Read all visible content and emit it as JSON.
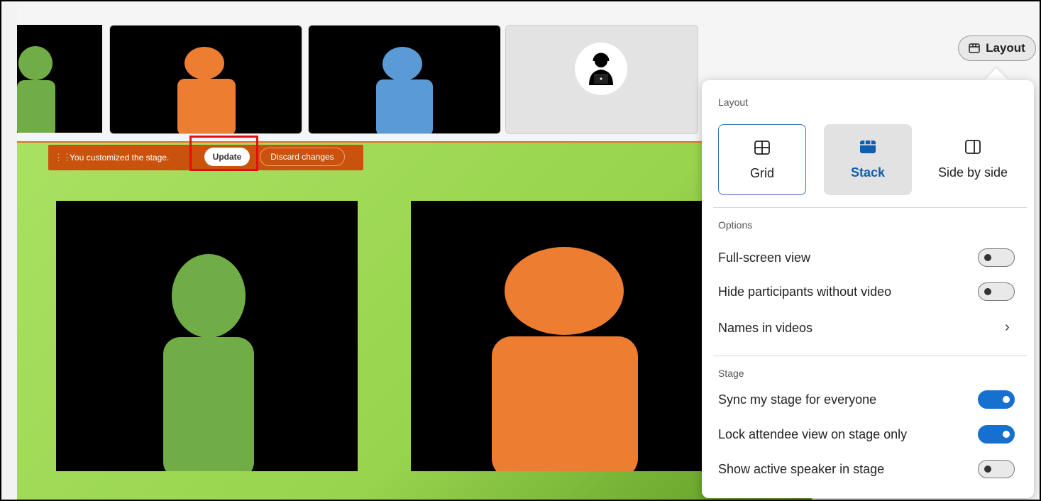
{
  "banner": {
    "message": "You customized the stage.",
    "update_label": "Update",
    "discard_label": "Discard changes"
  },
  "layout_button": {
    "label": "Layout",
    "icon": "layout-icon"
  },
  "panel": {
    "layout_section": "Layout",
    "options": [
      {
        "label": "Grid",
        "icon": "grid-icon",
        "selected": false
      },
      {
        "label": "Stack",
        "icon": "stack-icon",
        "selected": true
      },
      {
        "label": "Side by side",
        "icon": "side-by-side-icon",
        "selected": false
      }
    ],
    "options_section": "Options",
    "full_screen": {
      "label": "Full-screen view",
      "on": false
    },
    "hide_participants": {
      "label": "Hide participants without video",
      "on": false
    },
    "names_in_videos": {
      "label": "Names in videos"
    },
    "stage_section": "Stage",
    "sync_stage": {
      "label": "Sync my stage for everyone",
      "on": true
    },
    "lock_attendee": {
      "label": "Lock attendee view on stage only",
      "on": true
    },
    "show_active_speaker": {
      "label": "Show active speaker in stage",
      "on": false
    }
  },
  "colors": {
    "green_person": "#70ad47",
    "orange_person": "#ed7d31",
    "blue_person": "#5b9bd5",
    "stage_green": "#a9e162",
    "banner_orange": "#c9520c",
    "toggle_on": "#1670d0",
    "highlight": "#e01010"
  }
}
